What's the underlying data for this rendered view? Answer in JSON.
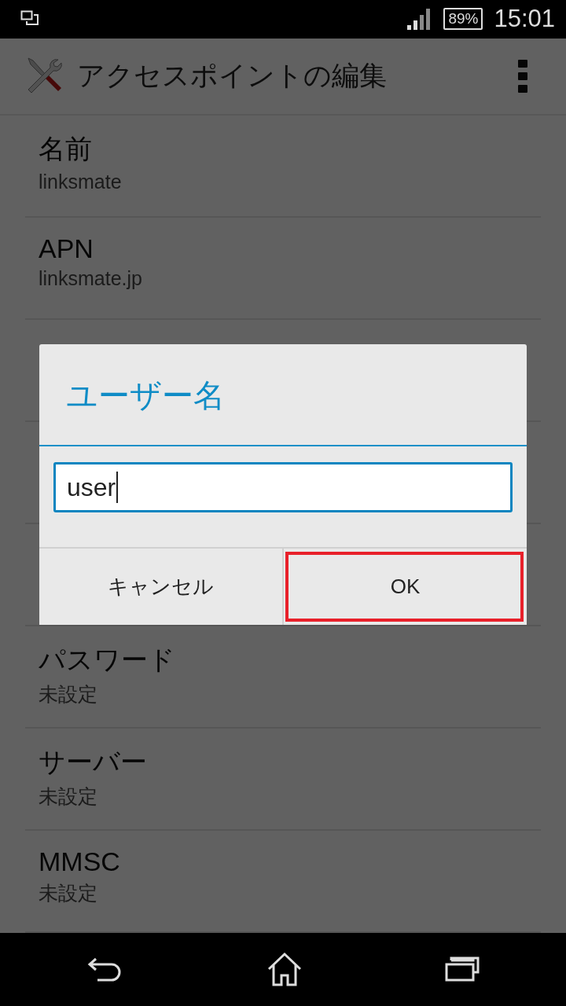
{
  "status_bar": {
    "battery": "89%",
    "time": "15:01"
  },
  "action_bar": {
    "title": "アクセスポイントの編集"
  },
  "settings_top": [
    {
      "title": "名前",
      "value": "linksmate"
    },
    {
      "title": "APN",
      "value": "linksmate.jp"
    }
  ],
  "settings_bottom": [
    {
      "title": "パスワード",
      "value": "未設定"
    },
    {
      "title": "サーバー",
      "value": "未設定"
    },
    {
      "title": "MMSC",
      "value": "未設定"
    }
  ],
  "dialog": {
    "title": "ユーザー名",
    "input": {
      "value": "user"
    },
    "buttons": [
      {
        "label": "キャンセル",
        "highlighted": false
      },
      {
        "label": "OK",
        "highlighted": true
      }
    ]
  }
}
